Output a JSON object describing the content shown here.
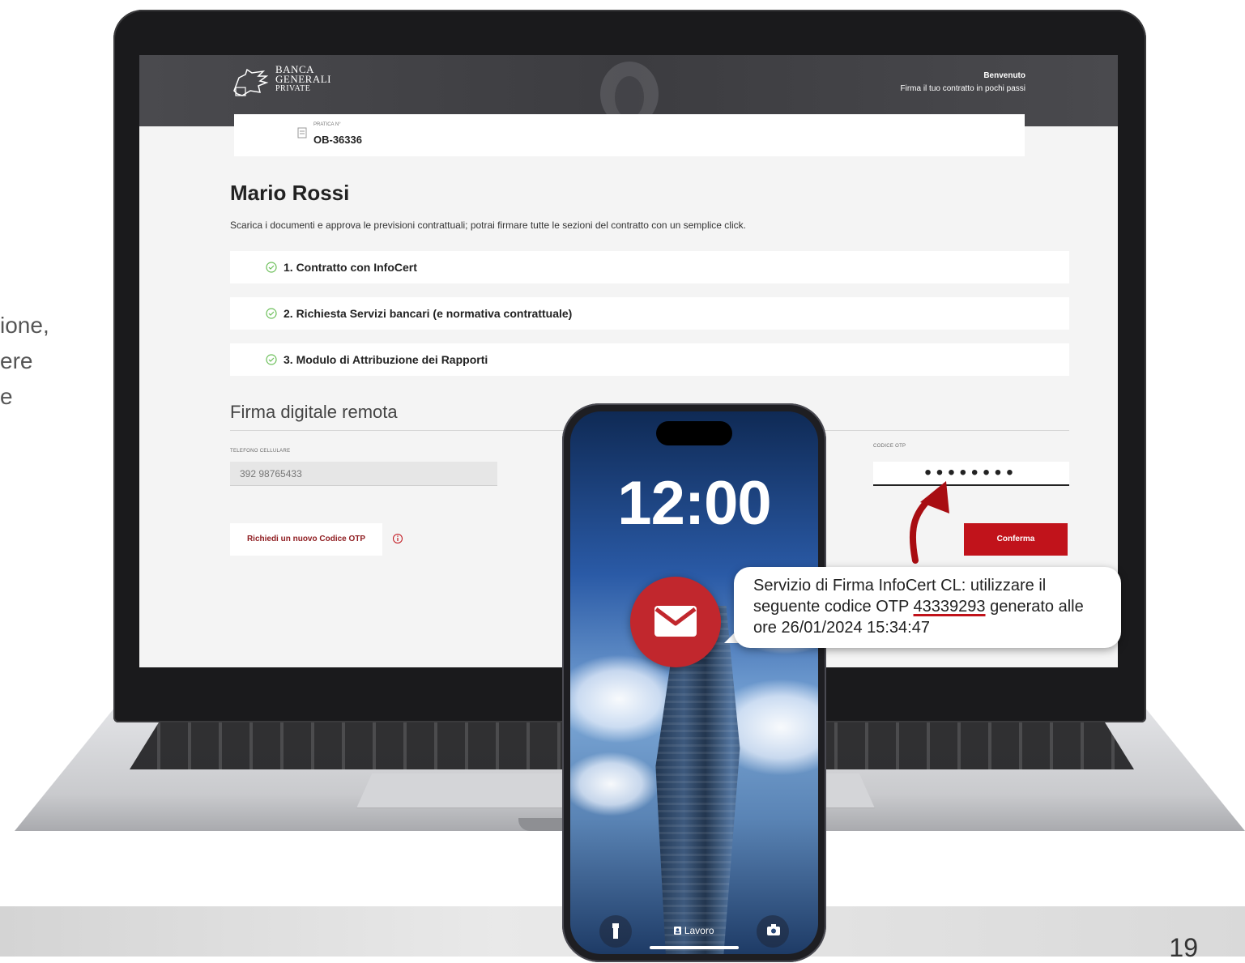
{
  "slide": {
    "side_text": [
      "ione,",
      "ere",
      "e"
    ],
    "page_number": "19"
  },
  "bank": {
    "logo_lines": [
      "BANCA",
      "GENERALI",
      "PRIVATE"
    ],
    "header_welcome": "Benvenuto",
    "header_subtitle": "Firma il tuo contratto in pochi passi"
  },
  "case": {
    "label": "PRATICA N°",
    "number": "OB-36336"
  },
  "client": {
    "name": "Mario Rossi",
    "intro": "Scarica i documenti e approva le previsioni contrattuali; potrai firmare tutte le sezioni del contratto con un semplice click."
  },
  "sections": [
    {
      "label": "1. Contratto con InfoCert"
    },
    {
      "label": "2. Richiesta Servizi bancari (e normativa contrattuale)"
    },
    {
      "label": "3. Modulo di Attribuzione dei Rapporti"
    }
  ],
  "signature": {
    "title": "Firma digitale remota",
    "phone_label": "TELEFONO CELLULARE",
    "phone_value": "392 98765433",
    "otp_label": "CODICE OTP",
    "otp_value": "••••••••",
    "request_otp_label": "Richiedi un nuovo Codice OTP",
    "confirm_label": "Conferma"
  },
  "phone": {
    "time": "12:00",
    "focus_mode": "Lavoro",
    "sms_before": "Servizio di Firma InfoCert CL: utilizzare il seguente codice OTP ",
    "sms_code": "43339293",
    "sms_after": " generato alle ore 26/01/2024 15:34:47"
  },
  "colors": {
    "accent_red": "#c1131b",
    "header_gray": "#4a4a4e",
    "check_green": "#6bbf59"
  },
  "icons": [
    "document-icon",
    "check-circle-icon",
    "info-icon",
    "mail-icon",
    "flashlight-icon",
    "camera-icon",
    "contact-icon",
    "lion-icon",
    "winged-lion-logo"
  ]
}
